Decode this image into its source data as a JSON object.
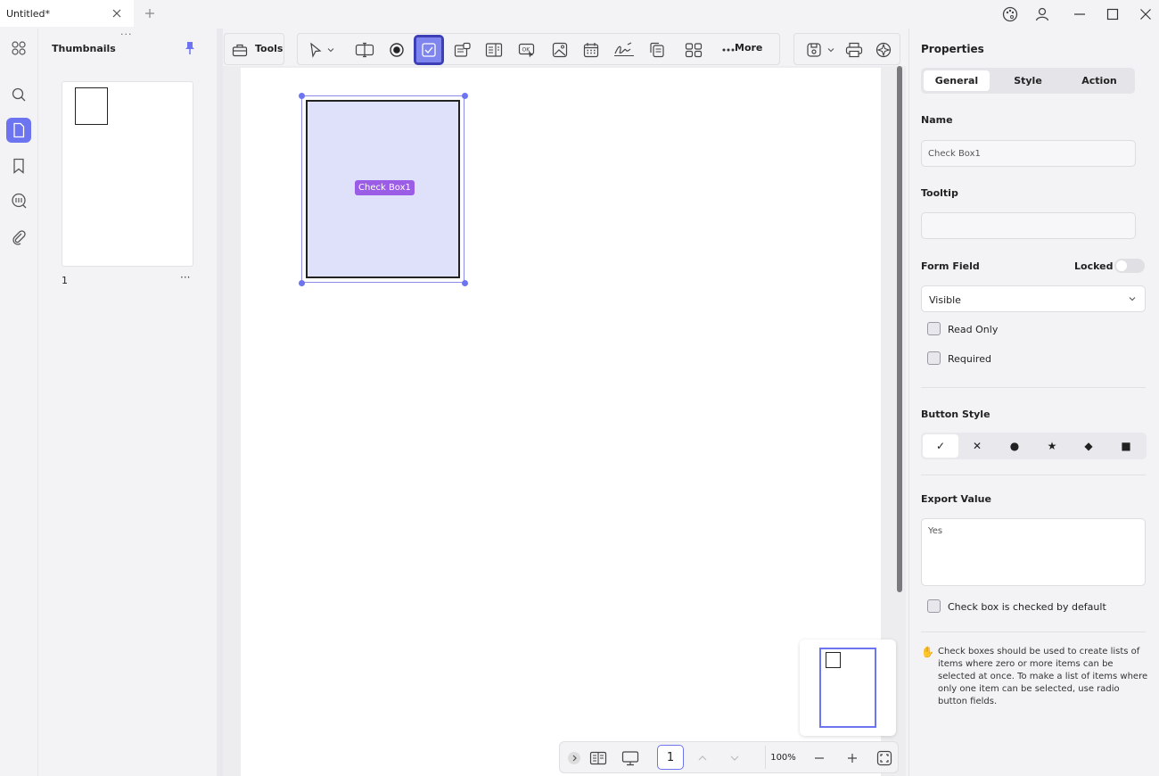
{
  "titlebar": {
    "tab_title": "Untitled*",
    "icons": [
      "palette-icon",
      "account-icon",
      "minimize-icon",
      "maximize-icon",
      "close-icon"
    ]
  },
  "rail": {
    "items": [
      "apps-icon",
      "search-icon",
      "pages-icon",
      "bookmark-icon",
      "comment-icon",
      "attachment-icon"
    ],
    "active": "pages-icon"
  },
  "thumbnails": {
    "title": "Thumbnails",
    "grip": "···",
    "more": "···",
    "pages": [
      {
        "number": "1"
      }
    ]
  },
  "toolbar": {
    "tools_label": "Tools",
    "more_label": "More",
    "selected_tool": "checkbox-tool"
  },
  "canvas": {
    "field_label": "Check Box1"
  },
  "bottombar": {
    "page_number": "1",
    "zoom": "100%"
  },
  "properties": {
    "title": "Properties",
    "tabs": [
      {
        "label": "General",
        "active": true
      },
      {
        "label": "Style",
        "active": false
      },
      {
        "label": "Action",
        "active": false
      }
    ],
    "name_label": "Name",
    "name_value": "Check Box1",
    "tooltip_label": "Tooltip",
    "tooltip_value": "",
    "form_field_label": "Form Field",
    "locked_label": "Locked",
    "locked": false,
    "visibility": "Visible",
    "read_only_label": "Read Only",
    "required_label": "Required",
    "button_style_label": "Button Style",
    "button_styles": [
      "✓",
      "✕",
      "●",
      "★",
      "◆",
      "■"
    ],
    "button_style_selected": "check",
    "export_value_label": "Export Value",
    "export_value": "Yes",
    "checked_default_label": "Check box is checked by default",
    "hint": "Check boxes should be used to create lists of items where zero or more items can be selected at once. To make a list of items where only one item can be selected, use radio button fields."
  },
  "colors": {
    "accent": "#6c74f0",
    "selected_outline": "#3c3fb5",
    "field_fill": "#dfe1fb",
    "tag": "#9b5de5"
  }
}
